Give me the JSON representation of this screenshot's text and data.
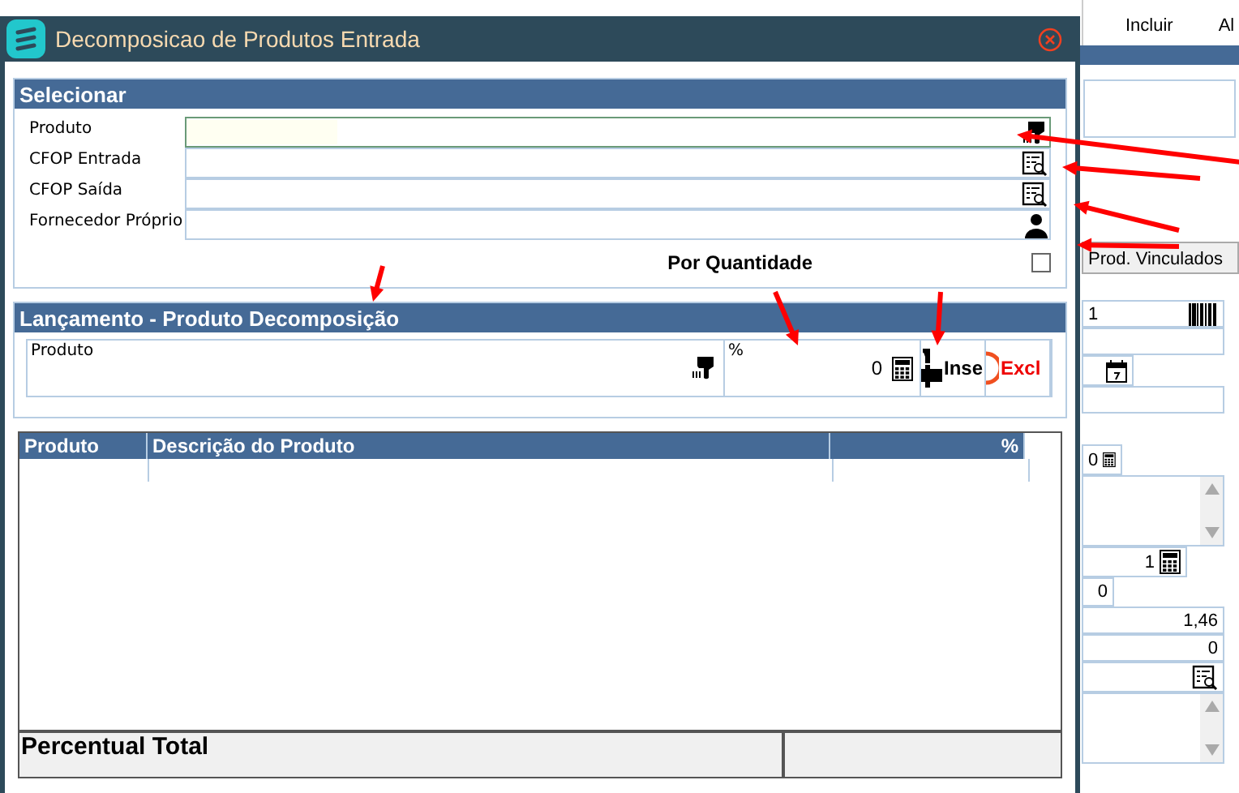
{
  "background_app": {
    "toolbar": [
      "Incluir",
      "Al"
    ],
    "tab": "Prod. Vinculados",
    "fields": [
      {
        "kind": "barcode",
        "value": "1"
      },
      {
        "kind": "plain"
      },
      {
        "kind": "date"
      },
      {
        "kind": "plain"
      },
      {
        "kind": "gap"
      },
      {
        "kind": "calc",
        "value": "0"
      },
      {
        "kind": "scroll"
      },
      {
        "kind": "calc",
        "value": "1"
      },
      {
        "kind": "small",
        "value": "0"
      },
      {
        "kind": "plain",
        "value": "1,46"
      },
      {
        "kind": "plain",
        "value": "0"
      },
      {
        "kind": "lookup"
      },
      {
        "kind": "scroll"
      }
    ]
  },
  "window": {
    "title": "Decomposicao de Produtos Entrada"
  },
  "selecionar": {
    "title": "Selecionar",
    "fields": [
      {
        "label": "Produto",
        "kind": "scanner",
        "focused": true
      },
      {
        "label": "CFOP Entrada",
        "kind": "lookup",
        "focused": false
      },
      {
        "label": "CFOP Saída",
        "kind": "lookup",
        "focused": false
      },
      {
        "label": "Fornecedor Próprio",
        "kind": "person",
        "focused": false
      }
    ],
    "por_quantidade": {
      "label": "Por Quantidade",
      "checked": false
    }
  },
  "lancamento": {
    "title": "Lançamento - Produto Decomposição",
    "produto_label": "Produto",
    "percent_label": "%",
    "percent_value": "0",
    "insert_button": "Inse",
    "delete_button": "Excl"
  },
  "table": {
    "columns": [
      "Produto",
      "Descrição do Produto",
      "%"
    ],
    "footer": "Percentual Total"
  }
}
